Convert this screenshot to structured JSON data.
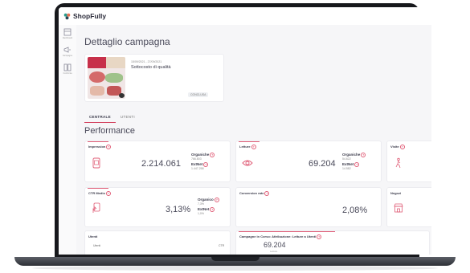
{
  "app": {
    "name": "ShopFully"
  },
  "nav": [
    {
      "icon": "dashboard-icon",
      "label": "Dashboard"
    },
    {
      "icon": "megaphone-icon",
      "label": "Campagne"
    },
    {
      "icon": "columns-icon",
      "label": "Confronta"
    }
  ],
  "page": {
    "title": "Dettaglio campagna"
  },
  "campaign": {
    "dates": "15/09/2021 - 27/09/2021",
    "name": "Sottocosto di qualità",
    "status": "CONCLUSA"
  },
  "tabs": [
    {
      "label": "CENTRALE",
      "active": true
    },
    {
      "label": "UTENTI",
      "active": false
    }
  ],
  "performance": {
    "title": "Performance",
    "cards": [
      {
        "title": "Impression",
        "icon": "phone-ad-icon",
        "value": "2.214.061",
        "organic_label": "Organiche",
        "organic_value": "766.803",
        "extnet_label": "ExtNet",
        "extnet_value": "1.447.258"
      },
      {
        "title": "Letture",
        "icon": "eye-icon",
        "value": "69.204",
        "organic_label": "Organiche",
        "organic_value": "54.622",
        "extnet_label": "ExtNet",
        "extnet_value": "14.582"
      },
      {
        "title": "Visite",
        "icon": "walking-icon"
      },
      {
        "title": "CTR Medio",
        "icon": "tap-icon",
        "value": "3,13%",
        "organic_label": "Organico",
        "organic_value": "7,3%",
        "extnet_label": "ExtNet",
        "extnet_value": "1,0%"
      },
      {
        "title": "Conversion rate",
        "value": "2,08%"
      },
      {
        "title": "Negozi",
        "icon": "store-icon"
      }
    ]
  },
  "bottom": {
    "users": {
      "title": "Utenti",
      "col_users": "Utenti",
      "col_ctr": "CTR"
    },
    "active": {
      "title": "Campagne in Corso: Attribuzione: Letture a Utenti",
      "value": "69.204",
      "sub": "Letture"
    }
  },
  "colors": {
    "accent": "#e05c76",
    "bezel": "#17181c",
    "background": "#f6f6f8"
  }
}
